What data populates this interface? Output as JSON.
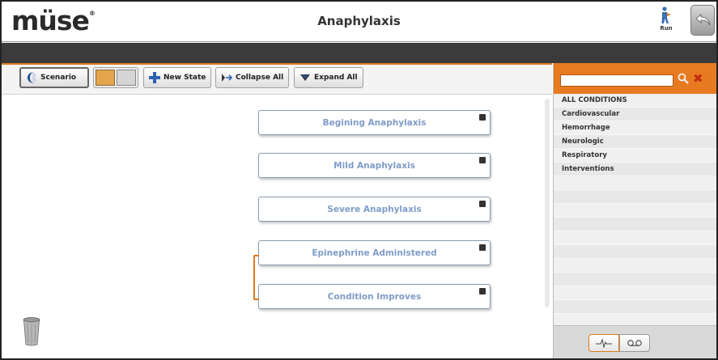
{
  "header": {
    "logo": "müse",
    "logo_mark": "®",
    "title": "Anaphylaxis",
    "run_label": "Run"
  },
  "toolbar": {
    "scenario_label": "Scenario",
    "new_state_label": "New State",
    "collapse_all_label": "Collapse All",
    "expand_all_label": "Expand All"
  },
  "states": [
    {
      "label": "Begining Anaphylaxis"
    },
    {
      "label": "Mild Anaphylaxis"
    },
    {
      "label": "Severe Anaphylaxis"
    },
    {
      "label": "Epinephrine Administered"
    },
    {
      "label": "Condition Improves"
    }
  ],
  "conditions_panel": {
    "search_value": "",
    "items": [
      "ALL CONDITIONS",
      "Cardiovascular",
      "Hemorrhage",
      "Neurologic",
      "Respiratory",
      "Interventions"
    ],
    "empty_rows": 11,
    "tabs": [
      {
        "icon": "waveform-icon",
        "active": true
      },
      {
        "icon": "voicemail-icon",
        "active": false
      }
    ]
  },
  "colors": {
    "accent_orange": "#e87b22",
    "state_text": "#7f9cc8",
    "dark_bar": "#3b3b3b"
  }
}
